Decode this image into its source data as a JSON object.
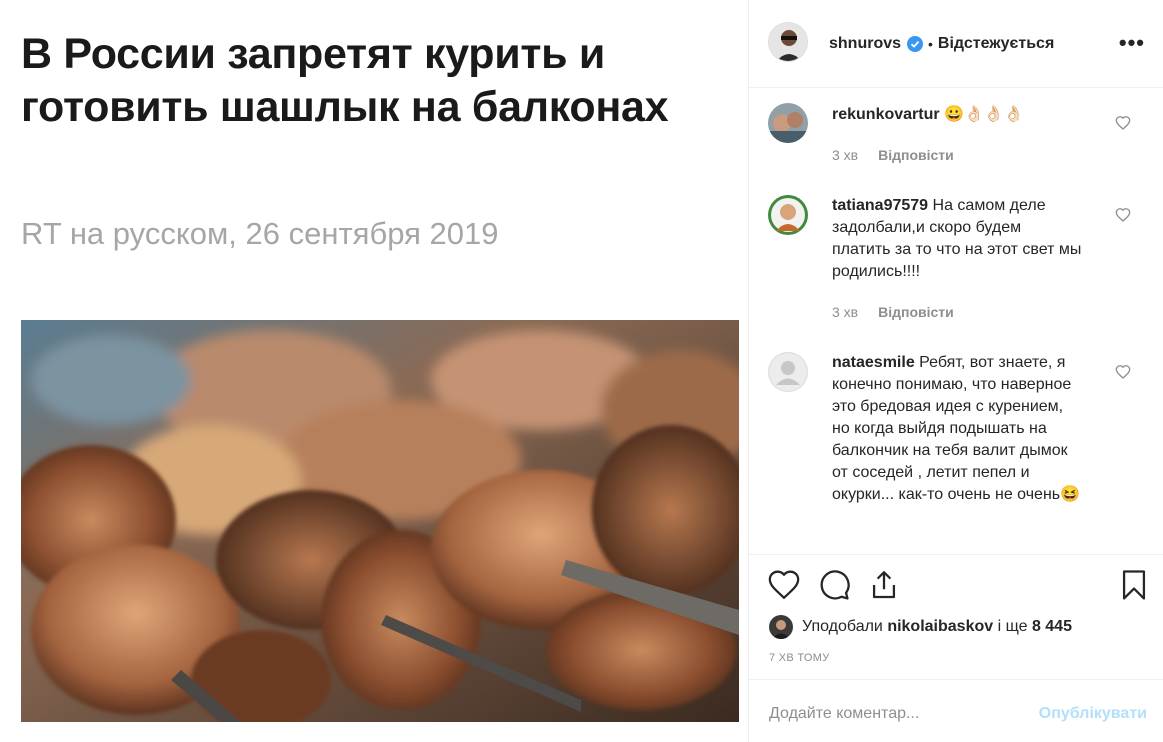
{
  "article": {
    "headline": "В России запретят курить и готовить шашлык на балконах",
    "byline": "RT на русском, 26 сентября 2019"
  },
  "header": {
    "username": "shnurovs",
    "separator": "•",
    "follow_label": "Відстежується",
    "more_label": "•••"
  },
  "comments": [
    {
      "username": "rekunkovartur",
      "text": "😀👌🏻👌🏻👌🏻",
      "time": "3 хв",
      "reply_label": "Відповісти"
    },
    {
      "username": "tatiana97579",
      "text": "На самом деле задолбали,и скоро будем платить за то что на этот свет мы родились!!!!",
      "time": "3 хв",
      "reply_label": "Відповісти"
    },
    {
      "username": "nataesmile",
      "text": "Ребят, вот знаете, я конечно понимаю, что наверное это бредовая идея с курением, но когда выйдя подышать на балкончик на тебя валит дымок от соседей , летит пепел и окурки... как-то очень не очень😆"
    }
  ],
  "likes": {
    "prefix": "Уподобали",
    "user": "nikolaibaskov",
    "middle": "і ще",
    "count": "8 445"
  },
  "timestamp": "7 ХВ ТОМУ",
  "add_comment": {
    "placeholder": "Додайте коментар...",
    "publish_label": "Опублікувати"
  },
  "colors": {
    "verified": "#3897f0",
    "publish_disabled": "#b2dffc",
    "meta_gray": "#8e8e8e",
    "byline_gray": "#a6a6a6"
  },
  "icons": [
    "heart-icon",
    "comment-icon",
    "share-icon",
    "bookmark-icon",
    "verified-badge-icon",
    "more-options-icon"
  ]
}
